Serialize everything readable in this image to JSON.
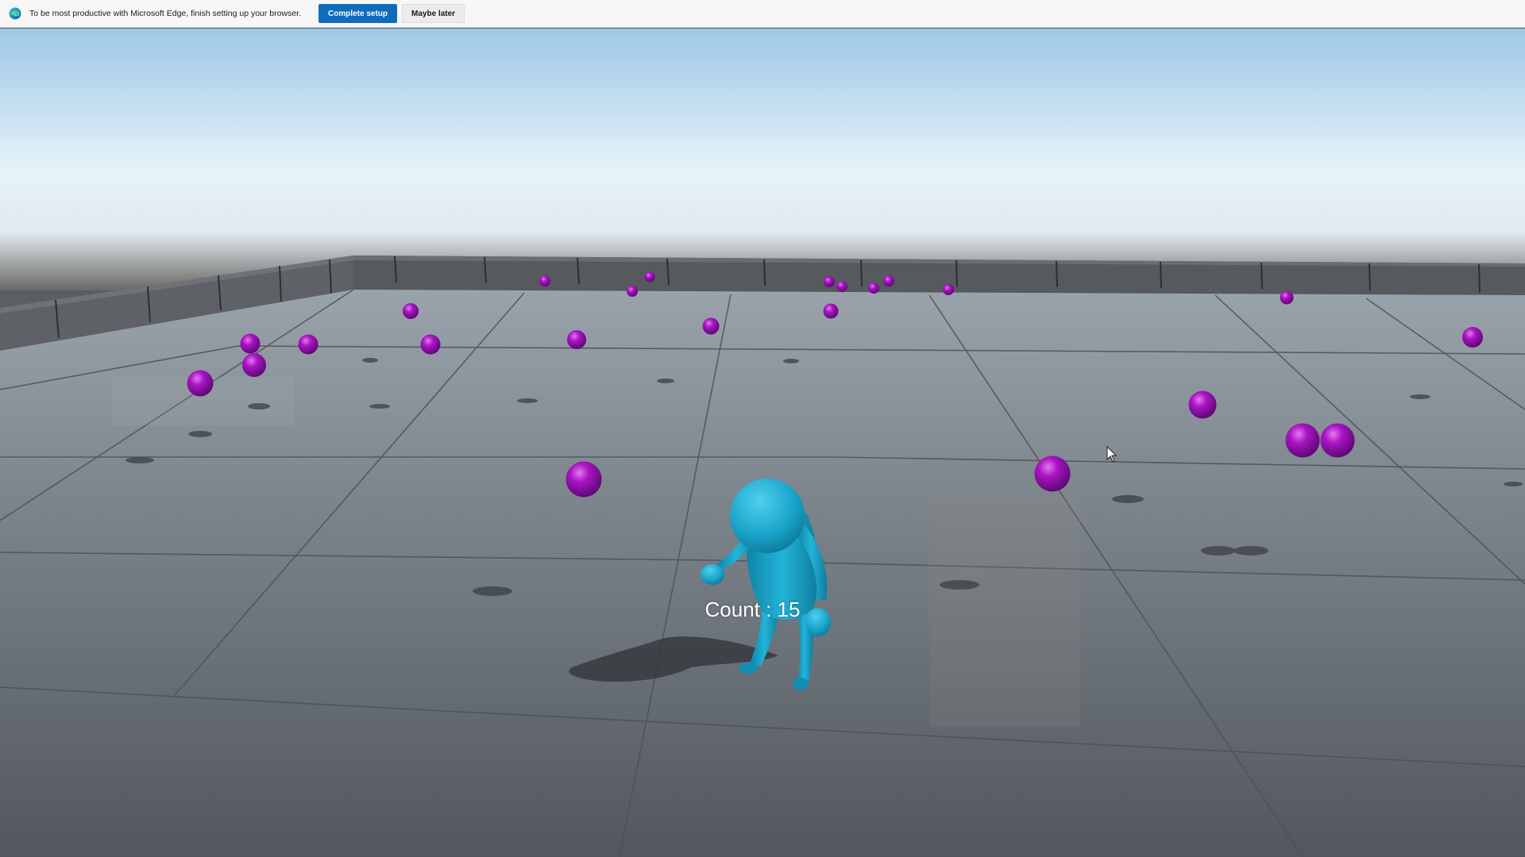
{
  "browser_bar": {
    "message": "To be most productive with Microsoft Edge, finish setting up your browser.",
    "complete_label": "Complete setup",
    "later_label": "Maybe later",
    "logo_icon": "edge-logo-icon"
  },
  "hud": {
    "count_text": "Count : 15"
  },
  "scene": {
    "player_color": "#1aa3c4",
    "pickup_color": "#9a0fb4",
    "sky_color": "#d8ecf6",
    "ground_color": "#6c737b",
    "pickups_visible": 29
  }
}
